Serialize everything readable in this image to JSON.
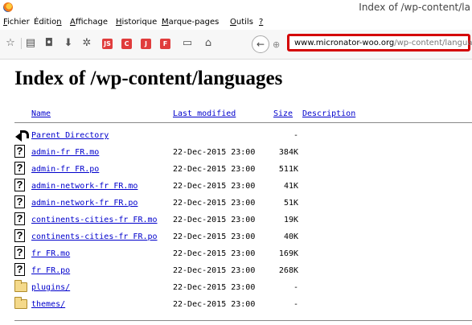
{
  "window": {
    "title": "Index of /wp-content/la"
  },
  "menubar": {
    "items": [
      {
        "label": "Fichier",
        "accel": "F"
      },
      {
        "label": "Édition",
        "accel": "n"
      },
      {
        "label": "Affichage",
        "accel": "A"
      },
      {
        "label": "Historique",
        "accel": "H"
      },
      {
        "label": "Marque-pages",
        "accel": "M"
      },
      {
        "label": "Outils",
        "accel": "O"
      },
      {
        "label": "?",
        "accel": "?"
      }
    ]
  },
  "toolbar": {
    "icons": [
      "star-icon",
      "reading-list-icon",
      "pocket-icon",
      "download-icon",
      "gear-icon"
    ],
    "badges": [
      {
        "label": "JS",
        "color": "#e03c3c"
      },
      {
        "label": "C",
        "color": "#e03c3c"
      },
      {
        "label": "J",
        "color": "#e03c3c"
      },
      {
        "label": "F",
        "color": "#e03c3c"
      }
    ],
    "url_domain": "www.micronator-woo.org",
    "url_path": "/wp-content/languages/"
  },
  "page": {
    "heading": "Index of /wp-content/languages",
    "columns": {
      "name": "Name",
      "modified": "Last modified",
      "size": "Size",
      "description": "Description"
    },
    "rows": [
      {
        "icon": "back",
        "name": "Parent Directory",
        "date": "",
        "size": "-"
      },
      {
        "icon": "unknown",
        "name": "admin-fr FR.mo",
        "date": "22-Dec-2015 23:00",
        "size": "384K"
      },
      {
        "icon": "unknown",
        "name": "admin-fr FR.po",
        "date": "22-Dec-2015 23:00",
        "size": "511K"
      },
      {
        "icon": "unknown",
        "name": "admin-network-fr FR.mo",
        "date": "22-Dec-2015 23:00",
        "size": "41K"
      },
      {
        "icon": "unknown",
        "name": "admin-network-fr FR.po",
        "date": "22-Dec-2015 23:00",
        "size": "51K"
      },
      {
        "icon": "unknown",
        "name": "continents-cities-fr FR.mo",
        "date": "22-Dec-2015 23:00",
        "size": "19K"
      },
      {
        "icon": "unknown",
        "name": "continents-cities-fr FR.po",
        "date": "22-Dec-2015 23:00",
        "size": "40K"
      },
      {
        "icon": "unknown",
        "name": "fr FR.mo",
        "date": "22-Dec-2015 23:00",
        "size": "169K"
      },
      {
        "icon": "unknown",
        "name": "fr FR.po",
        "date": "22-Dec-2015 23:00",
        "size": "268K"
      },
      {
        "icon": "folder",
        "name": "plugins/",
        "date": "22-Dec-2015 23:00",
        "size": "-"
      },
      {
        "icon": "folder",
        "name": "themes/",
        "date": "22-Dec-2015 23:00",
        "size": "-"
      }
    ]
  },
  "colors": {
    "link": "#0000cc",
    "url_highlight_border": "#d40000"
  }
}
